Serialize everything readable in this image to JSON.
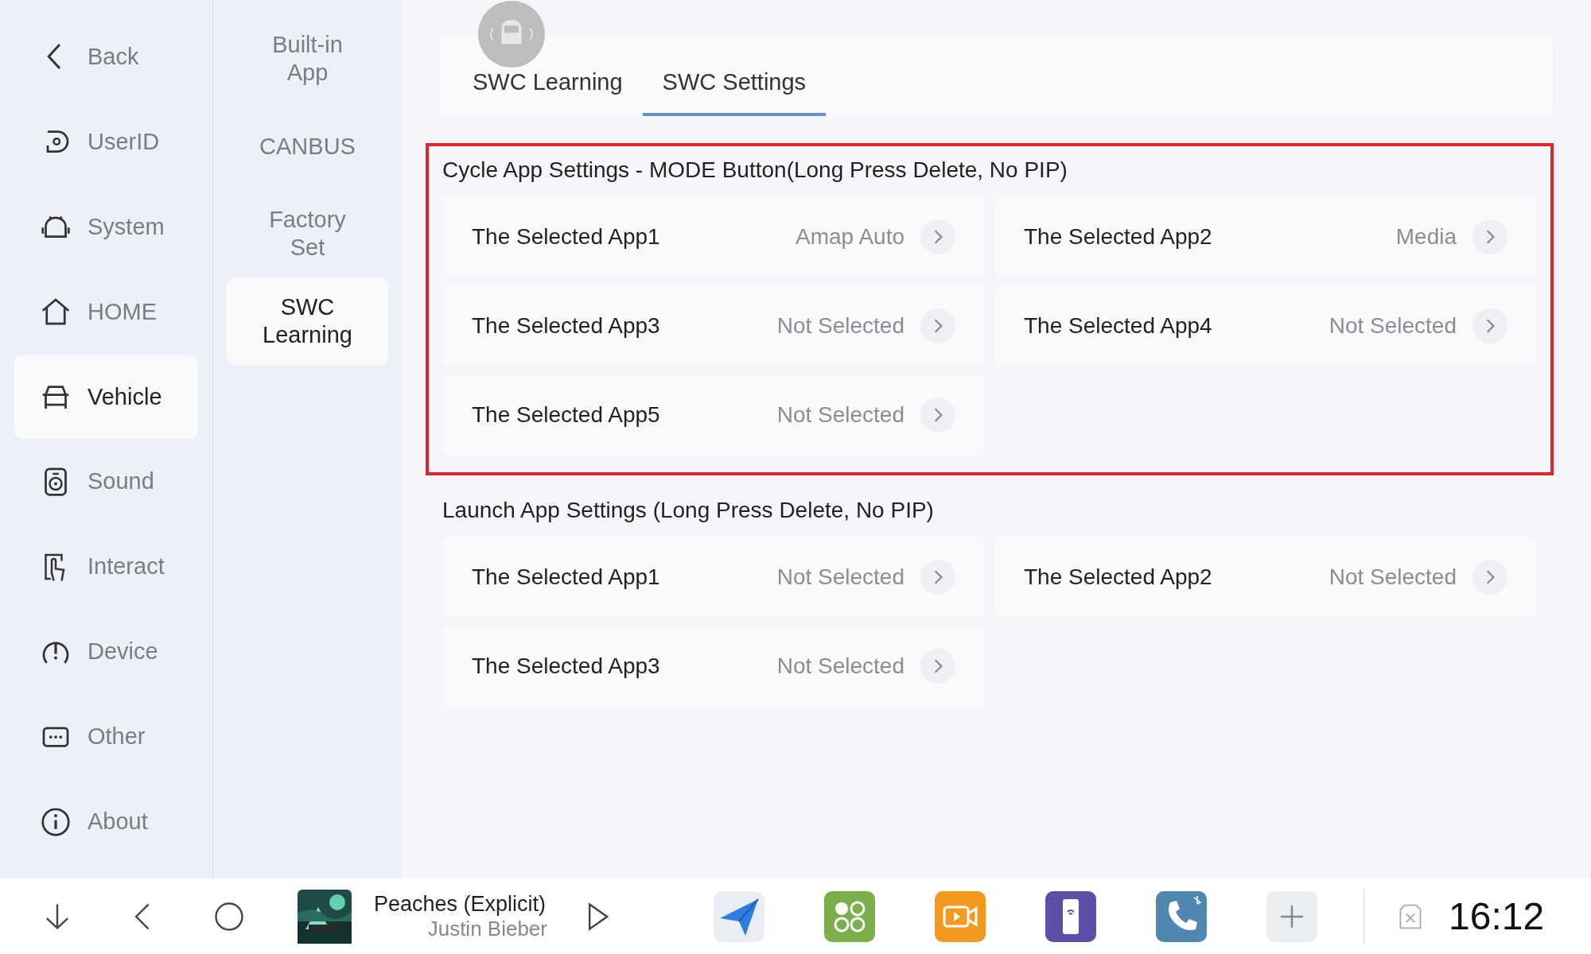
{
  "sidebar": {
    "back": "Back",
    "items": [
      {
        "label": "UserID",
        "selected": false
      },
      {
        "label": "System",
        "selected": false
      },
      {
        "label": "HOME",
        "selected": false
      },
      {
        "label": "Vehicle",
        "selected": true
      },
      {
        "label": "Sound",
        "selected": false
      },
      {
        "label": "Interact",
        "selected": false
      },
      {
        "label": "Device",
        "selected": false
      },
      {
        "label": "Other",
        "selected": false
      },
      {
        "label": "About",
        "selected": false
      }
    ]
  },
  "subnav": [
    {
      "label": "Built-in App",
      "selected": false
    },
    {
      "label": "CANBUS",
      "selected": false
    },
    {
      "label": "Factory Set",
      "selected": false
    },
    {
      "label": "SWC Learning",
      "selected": true
    }
  ],
  "tabs": [
    {
      "label": "SWC Learning",
      "selected": false
    },
    {
      "label": "SWC Settings",
      "selected": true
    }
  ],
  "sections": [
    {
      "title": "Cycle App Settings - MODE Button(Long Press Delete, No PIP)",
      "highlighted": true,
      "rows": [
        {
          "label": "The Selected App1",
          "value": "Amap Auto"
        },
        {
          "label": "The Selected App2",
          "value": "Media"
        },
        {
          "label": "The Selected App3",
          "value": "Not Selected"
        },
        {
          "label": "The Selected App4",
          "value": "Not Selected"
        },
        {
          "label": "The Selected App5",
          "value": "Not Selected"
        }
      ]
    },
    {
      "title": "Launch App Settings (Long Press Delete, No PIP)",
      "highlighted": false,
      "rows": [
        {
          "label": "The Selected App1",
          "value": "Not Selected"
        },
        {
          "label": "The Selected App2",
          "value": "Not Selected"
        },
        {
          "label": "The Selected App3",
          "value": "Not Selected"
        }
      ]
    }
  ],
  "taskbar": {
    "track": "Peaches (Explicit)",
    "artist": "Justin Bieber",
    "time": "16:12"
  }
}
